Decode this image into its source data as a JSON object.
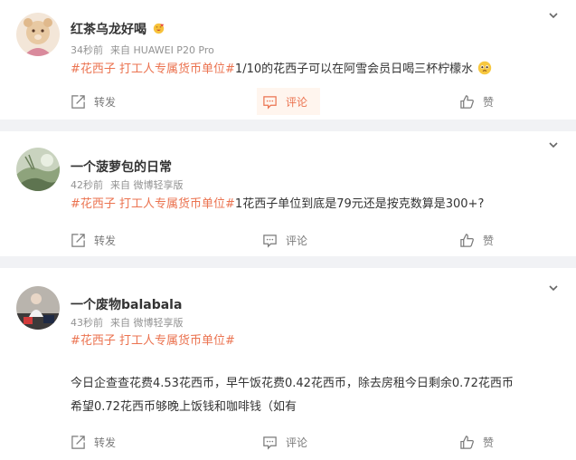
{
  "colors": {
    "tag": "#eb7350",
    "active": "#eb7350",
    "muted": "#939393"
  },
  "posts": [
    {
      "name": "红茶乌龙好喝",
      "time": "34秒前",
      "source": "来自 HUAWEI P20 Pro",
      "tags": "#花西子 打工人专属货币单位#",
      "text": "1/10的花西子可以在阿雪会员日喝三杯柠檬水",
      "emoji": "pleading-face-emoji",
      "actions": {
        "repost": "转发",
        "comment": "评论",
        "like": "赞"
      },
      "active_action": "comment"
    },
    {
      "name": "一个菠萝包的日常",
      "time": "42秒前",
      "source": "来自 微博轻享版",
      "tags": "#花西子 打工人专属货币单位#",
      "text": "1花西子单位到底是79元还是按克数算是300+?",
      "actions": {
        "repost": "转发",
        "comment": "评论",
        "like": "赞"
      }
    },
    {
      "name": "一个废物balabala",
      "time": "43秒前",
      "source": "来自 微博轻享版",
      "tags": "#花西子 打工人专属货币单位#",
      "body_line1": "今日企查查花费4.53花西币，早午饭花费0.42花西币，除去房租今日剩余0.72花西币",
      "body_line2": "希望0.72花西币够晚上饭钱和咖啡钱（如有",
      "actions": {
        "repost": "转发",
        "comment": "评论",
        "like": "赞"
      }
    }
  ]
}
